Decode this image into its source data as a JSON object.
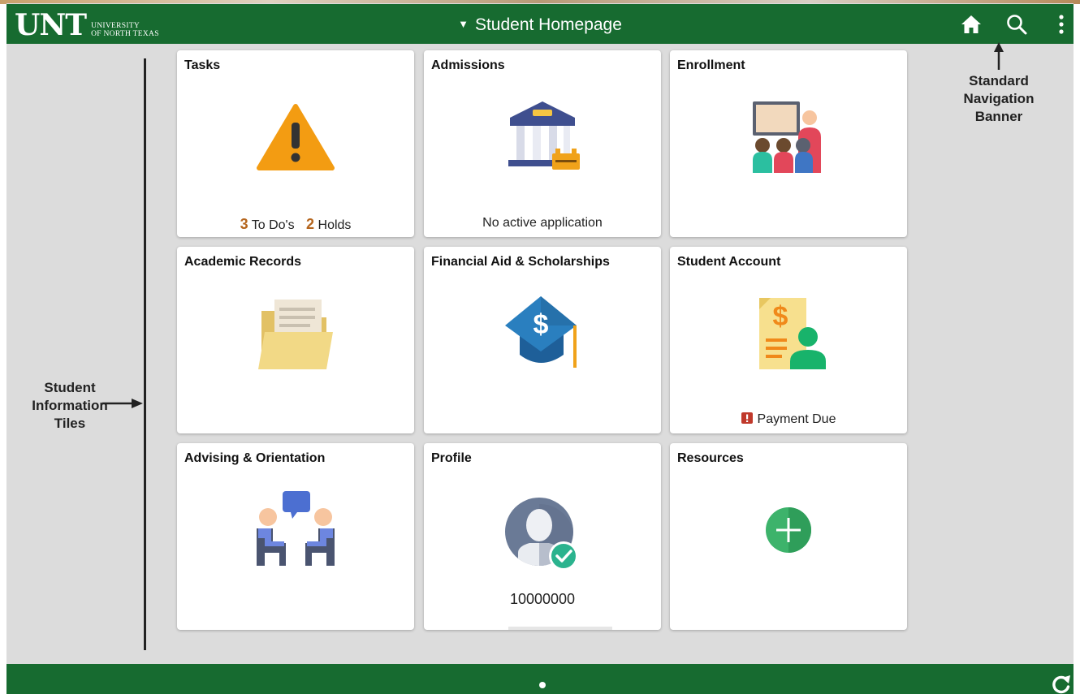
{
  "header": {
    "logo_text": "UNT",
    "logo_sub_line1": "UNIVERSITY",
    "logo_sub_line2": "OF NORTH TEXAS",
    "title": "Student Homepage"
  },
  "icons": {
    "home": "home-icon",
    "search": "search-icon",
    "menu": "more-vertical-icon",
    "refresh": "refresh-icon"
  },
  "annotations": {
    "left_line1": "Student",
    "left_line2": "Information",
    "left_line3": "Tiles",
    "right_line1": "Standard",
    "right_line2": "Navigation",
    "right_line3": "Banner"
  },
  "tiles": {
    "tasks": {
      "title": "Tasks",
      "todo_count": "3",
      "todo_label": "To Do's",
      "hold_count": "2",
      "hold_label": "Holds"
    },
    "admissions": {
      "title": "Admissions",
      "status": "No active application"
    },
    "enrollment": {
      "title": "Enrollment"
    },
    "academic_records": {
      "title": "Academic Records"
    },
    "financial_aid": {
      "title": "Financial Aid & Scholarships"
    },
    "student_account": {
      "title": "Student Account",
      "status": "Payment Due"
    },
    "advising": {
      "title": "Advising & Orientation"
    },
    "profile": {
      "title": "Profile",
      "id": "10000000"
    },
    "resources": {
      "title": "Resources"
    }
  },
  "colors": {
    "brand_green": "#176b30",
    "count_orange": "#b5651d",
    "alert_red": "#c0392b"
  }
}
